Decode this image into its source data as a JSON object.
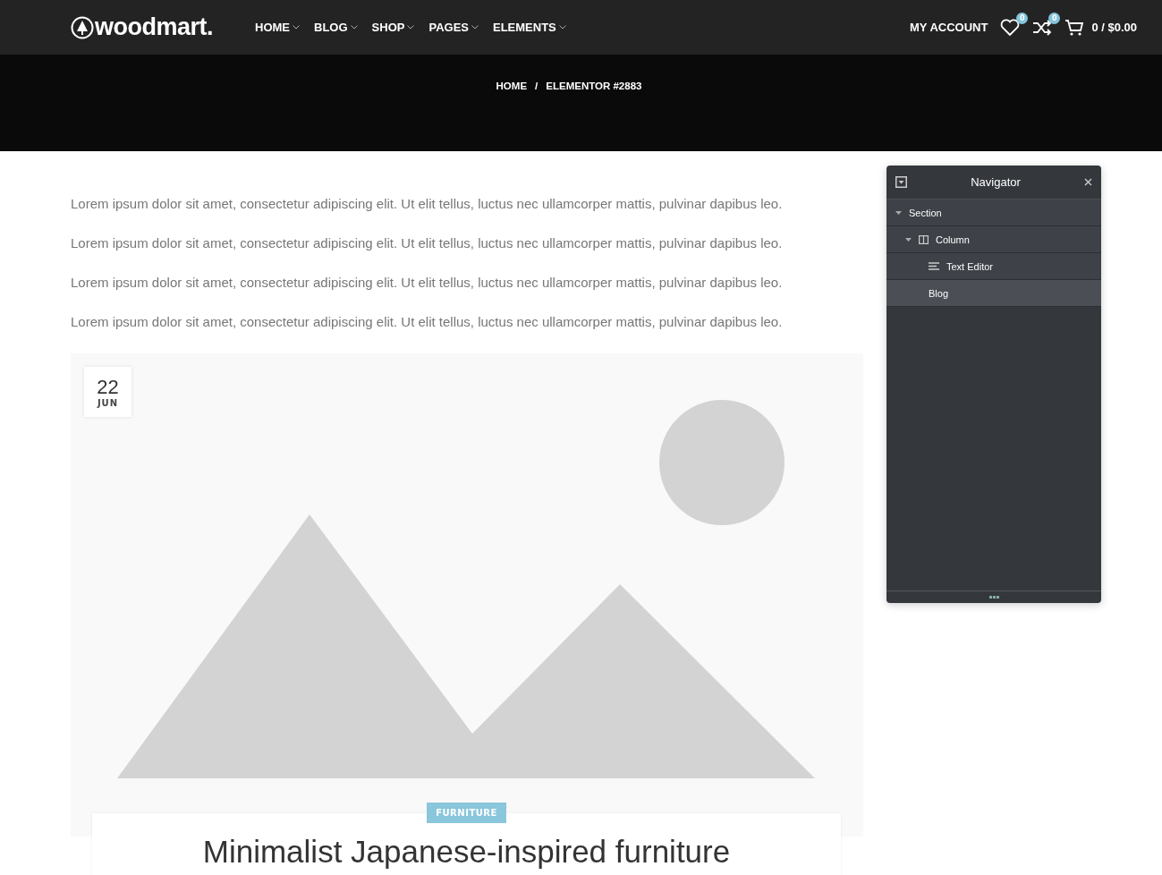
{
  "header": {
    "logo": "woodmart.",
    "menu": [
      {
        "label": "HOME"
      },
      {
        "label": "BLOG"
      },
      {
        "label": "SHOP"
      },
      {
        "label": "PAGES"
      },
      {
        "label": "ELEMENTS"
      }
    ],
    "account": "MY ACCOUNT",
    "wishlist_count": "0",
    "compare_count": "0",
    "cart": "0 / $0.00"
  },
  "breadcrumbs": [
    "HOME",
    "/",
    "ELEMENTOR #2883"
  ],
  "paragraphs": [
    "Lorem ipsum dolor sit amet, consectetur adipiscing elit. Ut elit tellus, luctus nec ullamcorper mattis, pulvinar dapibus leo.",
    "Lorem ipsum dolor sit amet, consectetur adipiscing elit. Ut elit tellus, luctus nec ullamcorper mattis, pulvinar dapibus leo.",
    "Lorem ipsum dolor sit amet, consectetur adipiscing elit. Ut elit tellus, luctus nec ullamcorper mattis, pulvinar dapibus leo.",
    "Lorem ipsum dolor sit amet, consectetur adipiscing elit. Ut elit tellus, luctus nec ullamcorper mattis, pulvinar dapibus leo."
  ],
  "post": {
    "date_day": "22",
    "date_month": "JUN",
    "category": "FURNITURE",
    "title": "Minimalist Japanese-inspired furniture"
  },
  "navigator": {
    "title": "Navigator",
    "items": [
      {
        "label": "Section",
        "expanded": true,
        "selected": false,
        "children": [
          {
            "label": "Column",
            "kind": "column",
            "expanded": true,
            "selected": false,
            "children": [
              {
                "label": "Text Editor",
                "kind": "text",
                "selected": false
              },
              {
                "label": "Blog",
                "selected": true
              }
            ]
          }
        ]
      }
    ]
  }
}
